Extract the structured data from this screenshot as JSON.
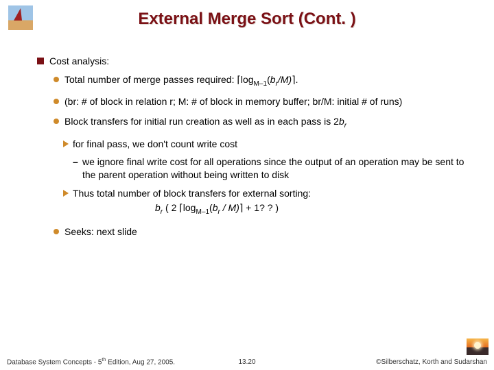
{
  "title": "External Merge Sort (Cont. )",
  "heading0": "Cost analysis:",
  "b1_pre": "Total number of merge passes required: ",
  "b1_ceilL": "⌈",
  "b1_log": "log",
  "b1_sub1": "M–1",
  "b1_open": "(",
  "b1_br": "b",
  "b1_r": "r",
  "b1_slashM": "/M)",
  "b1_ceilR": "⌉",
  "b1_dot": ".",
  "b2": "(br: # of block in relation r; M: # of block in memory buffer; br/M: initial # of runs)",
  "b3_pre": "Block transfers for initial run creation as well as in each pass is 2",
  "b3_b": "b",
  "b3_r": "r",
  "s1": "for final pass, we don't count write cost",
  "s2": "we ignore final write cost for all operations since the output of an operation may be sent to the parent operation without being written to disk",
  "s3": "Thus total number of block transfers for external sorting:",
  "f_br": "b",
  "f_r": "r",
  "f_open": " ( 2 ",
  "f_ceilL": "⌈",
  "f_log": "log",
  "f_sub": "M–1",
  "f_paren": "(",
  "f_b2": "b",
  "f_r2": "r",
  "f_rest": " / M)",
  "f_ceilR": "⌉",
  "f_tail": " + 1? ? )",
  "b4": "Seeks: next slide",
  "footer_left_a": "Database System Concepts - 5",
  "footer_left_th": "th",
  "footer_left_b": " Edition, Aug 27,  2005.",
  "footer_mid": "13.20",
  "footer_right": "©Silberschatz, Korth and Sudarshan"
}
